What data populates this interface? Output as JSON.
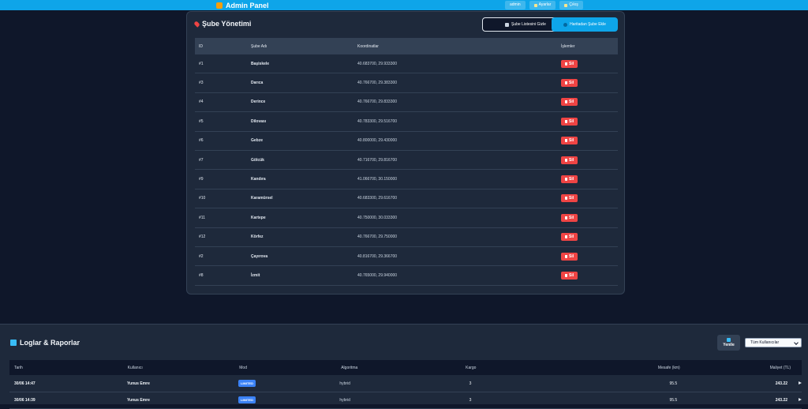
{
  "topbar": {
    "title": "Admin Panel",
    "user": "admin",
    "settings": "Ayarlar",
    "logout": "Çıkış"
  },
  "branches": {
    "title": "Şube Yönetimi",
    "list_button": "Şube Listesini Gizle",
    "add_button": "Haritadan Şube Ekle",
    "columns": [
      "ID",
      "Şube Adı",
      "Koordinatlar",
      "İşlemler"
    ],
    "delete_label": "Sil",
    "rows": [
      {
        "id": "#1",
        "name": "Başiskele",
        "coords": "40.683700, 29.933300"
      },
      {
        "id": "#3",
        "name": "Darıca",
        "coords": "40.766700, 29.383300"
      },
      {
        "id": "#4",
        "name": "Derince",
        "coords": "40.766700, 29.833300"
      },
      {
        "id": "#5",
        "name": "Dilovası",
        "coords": "40.783300, 29.516700"
      },
      {
        "id": "#6",
        "name": "Gebze",
        "coords": "40.800000, 29.430000"
      },
      {
        "id": "#7",
        "name": "Gölcük",
        "coords": "40.716700, 29.816700"
      },
      {
        "id": "#9",
        "name": "Kandıra",
        "coords": "41.066700, 30.150000"
      },
      {
        "id": "#10",
        "name": "Karamürsel",
        "coords": "40.683300, 29.616700"
      },
      {
        "id": "#11",
        "name": "Kartepe",
        "coords": "40.750000, 30.033300"
      },
      {
        "id": "#12",
        "name": "Körfez",
        "coords": "40.766700, 29.750000"
      },
      {
        "id": "#2",
        "name": "Çayırova",
        "coords": "40.816700, 29.366700"
      },
      {
        "id": "#8",
        "name": "İzmit",
        "coords": "40.765000, 29.940000"
      }
    ]
  },
  "logs": {
    "title": "Loglar & Raporlar",
    "refresh": "Yenile",
    "filter": "Tüm Kullanıcılar",
    "columns": [
      "Tarih",
      "Kullanıcı",
      "Mod",
      "Algoritma",
      "Kargo",
      "Mesafe (km)",
      "Maliyet (TL)"
    ],
    "rows": [
      {
        "date": "30/06 14:47",
        "user": "Yunus Emre",
        "mode": "LIMITED",
        "algo": "hybrid",
        "cargo": "3",
        "distance": "95.5",
        "cost": "243.22"
      },
      {
        "date": "30/06 14:39",
        "user": "Yunus Emre",
        "mode": "LIMITED",
        "algo": "hybrid",
        "cargo": "3",
        "distance": "95.5",
        "cost": "243.22"
      }
    ]
  },
  "colors": {
    "background": "#0f172a",
    "accent": "#0ea5e9",
    "danger": "#ef4444",
    "badge": "#3b82f6"
  }
}
